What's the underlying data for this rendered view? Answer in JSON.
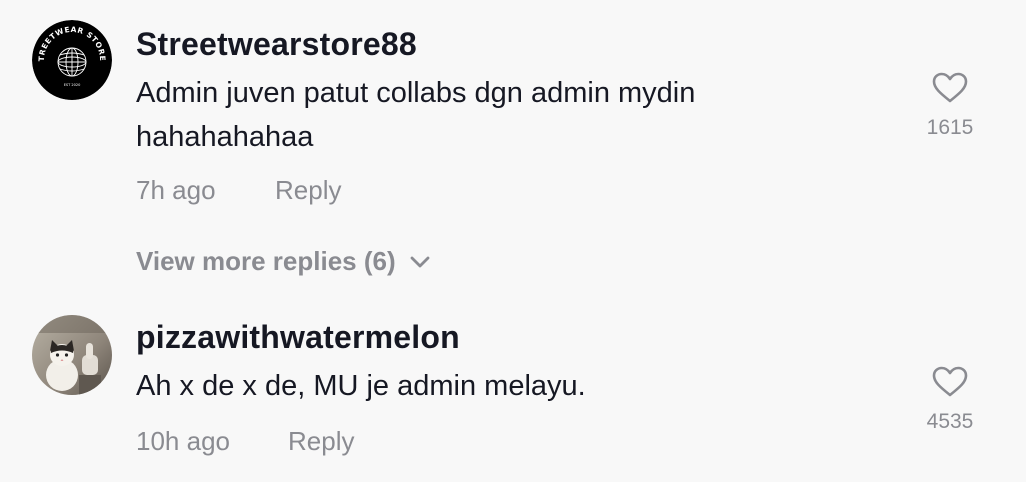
{
  "comments": [
    {
      "username": "Streetwearstore88",
      "text": "Admin juven patut collabs dgn admin mydin hahahahahaa",
      "time": "7h ago",
      "reply_label": "Reply",
      "likes": "1615",
      "avatar": {
        "ring_text": "STREETWEAR STORES",
        "sub_text": "EST 2020",
        "icon": "globe-logo-icon"
      }
    },
    {
      "username": "pizzawithwatermelon",
      "text": "Ah x de x de, MU je admin melayu.",
      "time": "10h ago",
      "reply_label": "Reply",
      "likes": "4535",
      "avatar": {
        "icon": "cat-thumbs-up-photo"
      }
    }
  ],
  "view_more": {
    "label": "View more replies (6)",
    "icon": "chevron-down-icon"
  },
  "colors": {
    "background": "#f8f8f8",
    "username": "#161823",
    "secondary": "#8a8b91"
  }
}
